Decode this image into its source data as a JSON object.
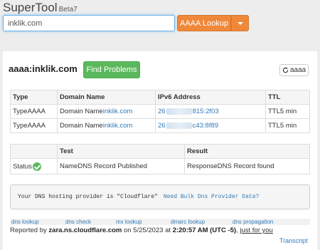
{
  "header": {
    "brand": "SuperTool",
    "version": "Beta7"
  },
  "search": {
    "value": "inklik.com",
    "lookup_label": "AAAA Lookup"
  },
  "result": {
    "domain_title": "aaaa:inklik.com",
    "find_problems_label": "Find Problems",
    "refresh_label": "aaaa",
    "columns": [
      "Type",
      "Domain Name",
      "IPv6 Address",
      "TTL"
    ],
    "rows": [
      {
        "type": "TypeAAAA",
        "domain_prefix": "Domain Name",
        "domain": "inklik.com",
        "ip_start": "26",
        "ip_end": "815:2f03",
        "ttl": "TTL5 min"
      },
      {
        "type": "TypeAAAA",
        "domain_prefix": "Domain Name",
        "domain": "inklik.com",
        "ip_start": "26",
        "ip_end": "c43:8f89",
        "ttl": "TTL5 min"
      }
    ]
  },
  "tests": {
    "columns": [
      "",
      "Test",
      "Result"
    ],
    "rows": [
      {
        "status": "Status",
        "test": "NameDNS Record Published",
        "result": "ResponseDNS Record found"
      }
    ]
  },
  "dns_notice": {
    "text": "Your DNS hosting provider is \"Cloudflare\"",
    "link": "Need Bulk Dns Provider Data?"
  },
  "footer": {
    "links": [
      "dns lookup",
      "dns check",
      "mx lookup",
      "dmarc lookup",
      "dns propagation"
    ],
    "reported_prefix": "Reported by",
    "server": "zara.ns.cloudflare.com",
    "on": "on 5/25/2023 at",
    "time": "2:20:57 AM (UTC -5)",
    "just_for_you": "just for you",
    "transcript": "Transcript"
  },
  "colors": {
    "accent_orange": "#f0883a",
    "accent_green": "#5cb85c",
    "link_blue": "#337ab7"
  },
  "icons": [
    "refresh-icon",
    "check-circle-icon",
    "caret-down-icon"
  ]
}
